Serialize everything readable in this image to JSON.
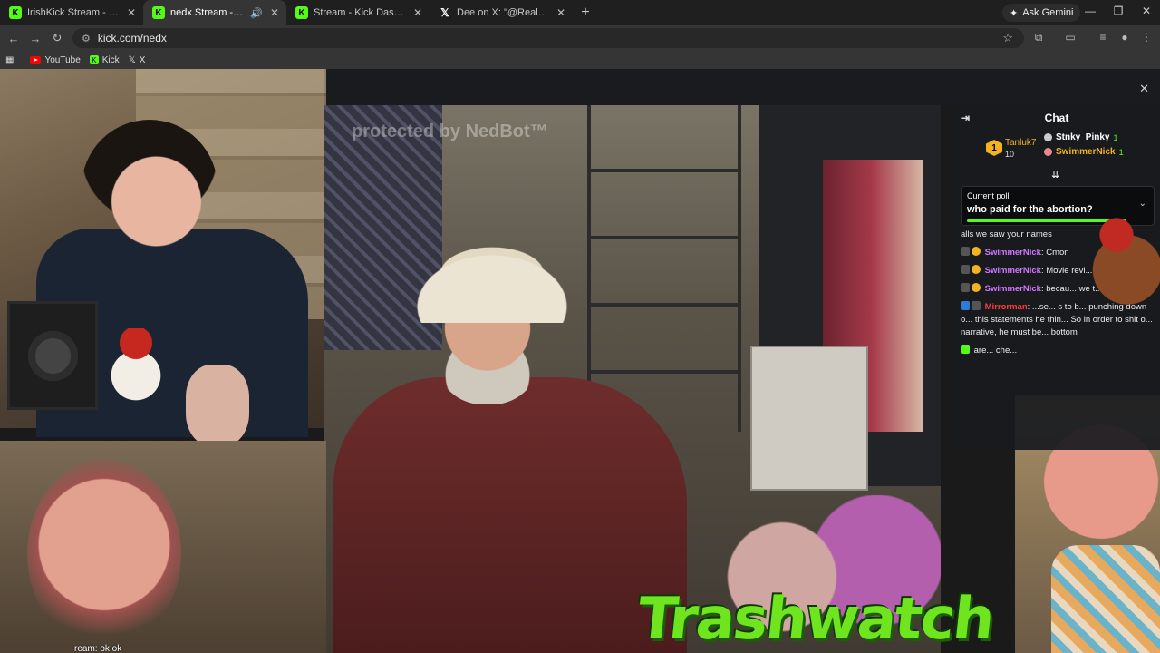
{
  "browser": {
    "tabs": [
      {
        "title": "IrishKick Stream - Watch Live o",
        "icon": "kick",
        "active": false
      },
      {
        "title": "nedx Stream - Watch Live o",
        "icon": "kick",
        "active": true,
        "audio": true
      },
      {
        "title": "Stream - Kick Dashboard",
        "icon": "kick",
        "active": false
      },
      {
        "title": "Dee on X: \"@RealBabbanaras",
        "icon": "x",
        "active": false
      }
    ],
    "gemini_label": "Ask Gemini",
    "url": "kick.com/nedx",
    "bookmarks": [
      {
        "label": "YouTube",
        "icon": "youtube"
      },
      {
        "label": "Kick",
        "icon": "kick"
      },
      {
        "label": "X",
        "icon": "x"
      }
    ]
  },
  "stream": {
    "watermark": "protected by NedBot™",
    "title_overlay": "Trashwatch",
    "bottom_caption": "ream: ok ok"
  },
  "chat": {
    "title": "Chat",
    "top_gifter": {
      "name": "Tanluk7",
      "rank": "1",
      "count": "10"
    },
    "gifters": [
      {
        "name": "Stnky_Pinky",
        "count": "1",
        "color": "#ffffff"
      },
      {
        "name": "SwimmerNick",
        "count": "1",
        "color": "#f2b31f"
      }
    ],
    "poll": {
      "label": "Current poll",
      "question": "who paid for the abortion?"
    },
    "messages": [
      {
        "user": "",
        "text": "alls we saw your names"
      },
      {
        "user": "SwimmerNick",
        "text": "Cmon"
      },
      {
        "user": "SwimmerNick",
        "text": "Movie revi... content"
      },
      {
        "user": "SwimmerNick",
        "text": "becau... we t..."
      },
      {
        "user": "Mirrorman",
        "text": "...se... s to b... punching down o... this statements he thin... So in order to shit o... narrative, he must be... bottom"
      },
      {
        "user": "",
        "text": "are... che..."
      }
    ]
  }
}
